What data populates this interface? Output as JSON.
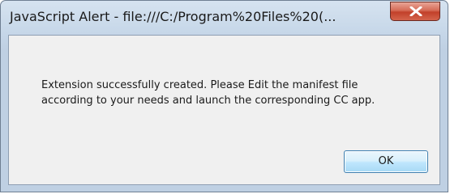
{
  "window": {
    "title": "JavaScript Alert - file:///C:/Program%20Files%20(...",
    "close_icon": "close-x-icon"
  },
  "dialog": {
    "message_line1": "Extension successfully created. Please Edit the manifest file",
    "message_line2": "according to your needs and launch the corresponding CC app.",
    "ok_label": "OK"
  },
  "colors": {
    "frame": "#c5d6e8",
    "close_button": "#c2402a",
    "client_bg": "#f0f0f0",
    "ok_border": "#3c7fb1"
  }
}
